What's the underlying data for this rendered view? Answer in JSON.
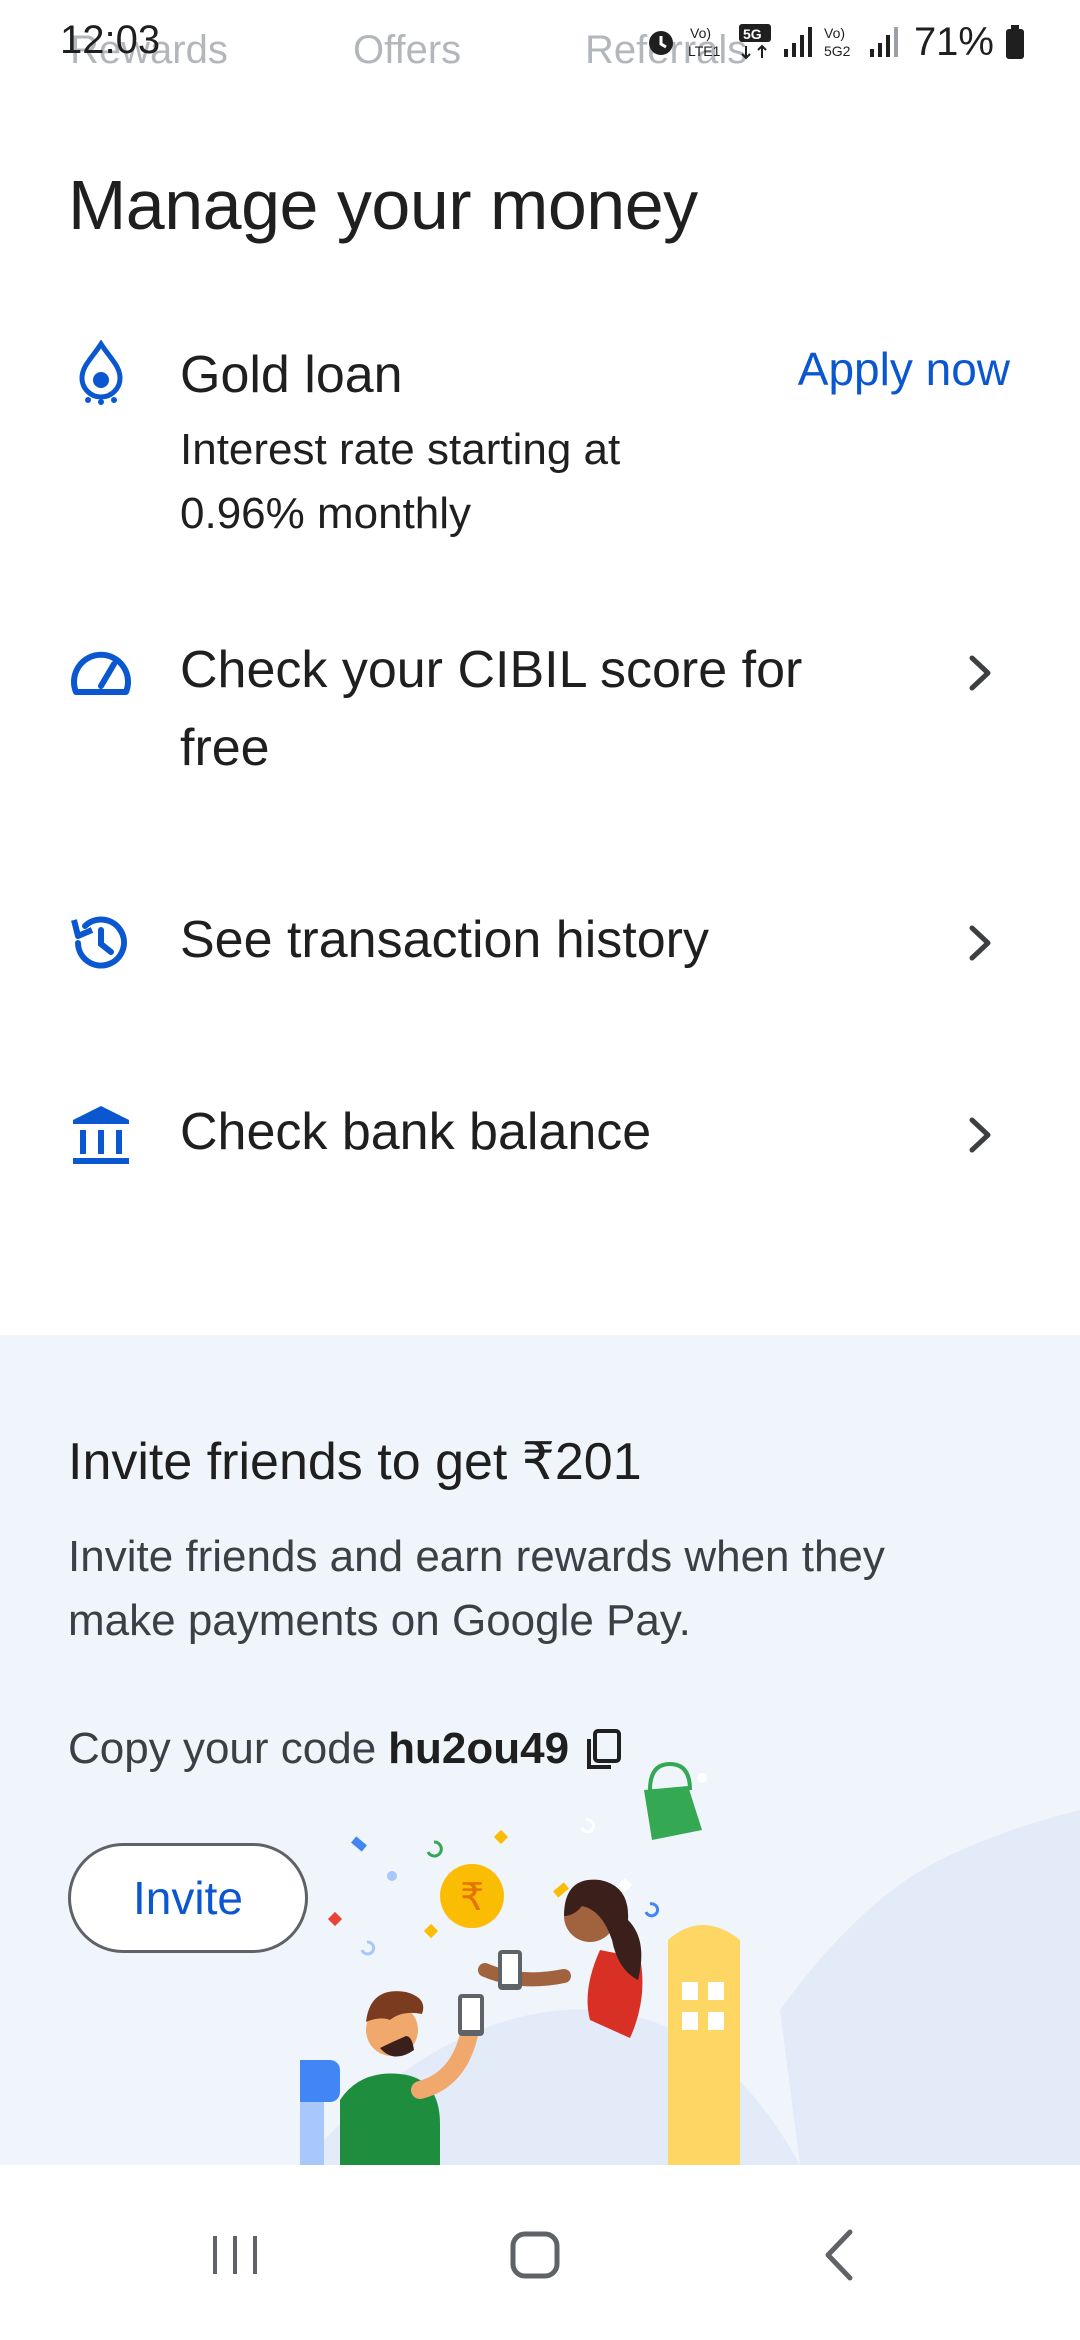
{
  "status_bar": {
    "time": "12:03",
    "battery": "71%",
    "net1": "Vo) LTE1",
    "net_badge": "5G",
    "net2": "Vo) 5G2"
  },
  "top_tabs": [
    "Rewards",
    "Offers",
    "Referrals"
  ],
  "page": {
    "title": "Manage your money"
  },
  "gold_loan": {
    "title": "Gold loan",
    "subtitle_line1": "Interest rate starting at",
    "subtitle_line2": "0.96% monthly",
    "action": "Apply now",
    "icon": "gold-drop-icon"
  },
  "items": [
    {
      "line1": "Check your CIBIL score for",
      "line2": "free",
      "icon": "speedometer-icon"
    },
    {
      "line1": "See transaction history",
      "icon": "history-icon"
    },
    {
      "line1": "Check bank balance",
      "icon": "bank-icon"
    }
  ],
  "invite": {
    "title": "Invite friends to get ₹201",
    "description": "Invite friends and earn rewards when they make payments on Google Pay.",
    "code_label": "Copy your code",
    "code": "hu2ou49",
    "button": "Invite"
  },
  "colors": {
    "accent": "#0b57d0",
    "invite_bg": "#f0f4fb",
    "text": "#1f1f1f"
  }
}
